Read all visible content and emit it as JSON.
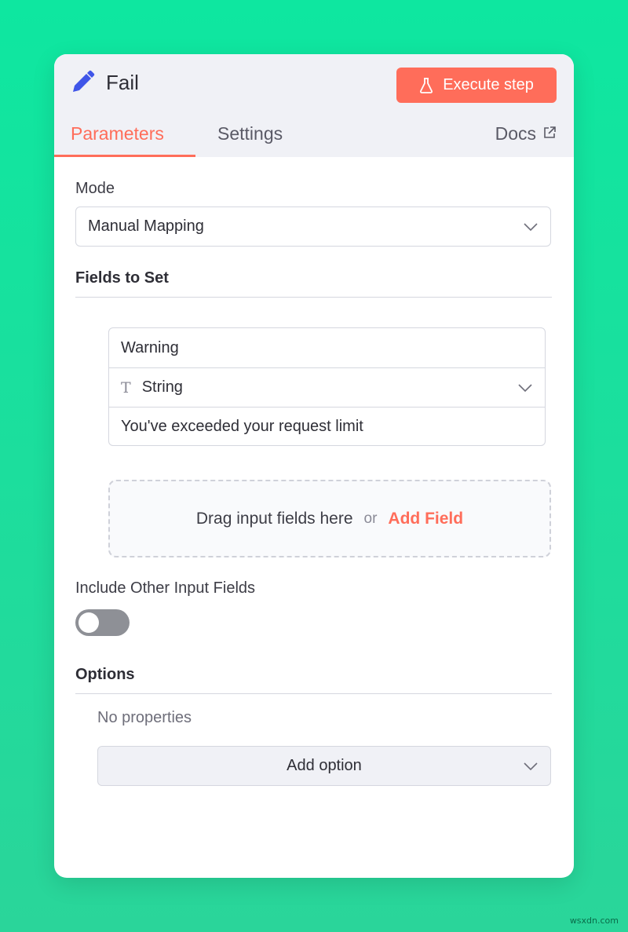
{
  "node": {
    "title": "Fail",
    "execute_label": "Execute step"
  },
  "tabs": {
    "parameters": "Parameters",
    "settings": "Settings",
    "docs": "Docs"
  },
  "mode": {
    "label": "Mode",
    "value": "Manual Mapping"
  },
  "fields_section": {
    "title": "Fields to Set"
  },
  "field": {
    "name": "Warning",
    "type": "String",
    "value": "You've exceeded your request limit"
  },
  "dropzone": {
    "text": "Drag input fields here",
    "or": "or",
    "add_label": "Add Field"
  },
  "include_other": {
    "label": "Include Other Input Fields",
    "enabled": false
  },
  "options": {
    "title": "Options",
    "empty_text": "No properties",
    "add_label": "Add option"
  },
  "watermark": "wsxdn.com",
  "colors": {
    "accent": "#ff6d5a",
    "background": "#0ee7a0",
    "icon_blue": "#3f55e8"
  }
}
